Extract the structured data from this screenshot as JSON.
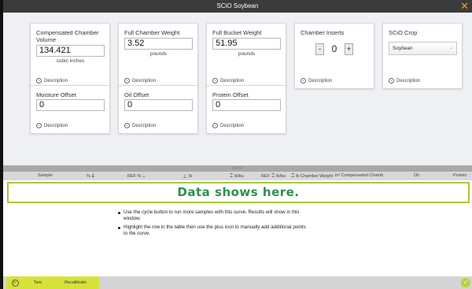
{
  "window": {
    "title": "SCiO Soybean",
    "close_glyph": "✕"
  },
  "cards": {
    "compensated_volume": {
      "label": "Compensated Chamber Volume",
      "value": "134.421",
      "unit": "cubic inches",
      "desc": "Description"
    },
    "full_chamber_weight": {
      "label": "Full Chamber Weight",
      "value": "3.52",
      "unit": "pounds",
      "desc": "Description"
    },
    "full_bucket_weight": {
      "label": "Full Bucket Weight",
      "value": "51.95",
      "unit": "pounds",
      "desc": "Description"
    },
    "chamber_inserts": {
      "label": "Chamber Inserts",
      "value": "0",
      "minus": "-",
      "plus": "+",
      "desc": "Description"
    },
    "scio_crop": {
      "label": "SCiO Crop",
      "value": "Soybean",
      "desc": "Description"
    },
    "moisture_offset": {
      "label": "Moisture Offset",
      "value": "0",
      "desc": "Description"
    },
    "oil_offset": {
      "label": "Oil Offset",
      "value": "0",
      "desc": "Description"
    },
    "protein_offset": {
      "label": "Protein Offset",
      "value": "0",
      "desc": "Description"
    }
  },
  "splitter_grip": "◊◊◊◊",
  "columns": {
    "sample": "Sample",
    "pct": "%",
    "ref_pct": "REF %",
    "lb": "lb",
    "lb_bu": "lb/bu",
    "ref_lb_bu": "REF",
    "ref_lb_bu_unit": "lb/bu",
    "chamber_weight": "lb Chamber Weight",
    "compensated": "in³ Compensated Chamb",
    "oil": "Oil",
    "protein": "Protein"
  },
  "data_placeholder": "Data shows here.",
  "hints": [
    "Use the cycle button to run more samples with this curve. Results will show in this window.",
    "Highlight the row in the table then use the plus icon to manually add additional points to the curve."
  ],
  "bottom": {
    "tare": "Tare",
    "recalibrate": "Recalibrate",
    "play_glyph": "▷",
    "ok_glyph": "✓"
  },
  "colors": {
    "accent_green": "#b5d33a",
    "data_text": "#2f8f4e",
    "close": "#f0a020",
    "button_yellow": "#d6e23a"
  },
  "icons": {
    "drop": "drop-icon",
    "weight": "weight-icon",
    "density": "density-icon",
    "description": "chevron-down-circle-icon"
  }
}
